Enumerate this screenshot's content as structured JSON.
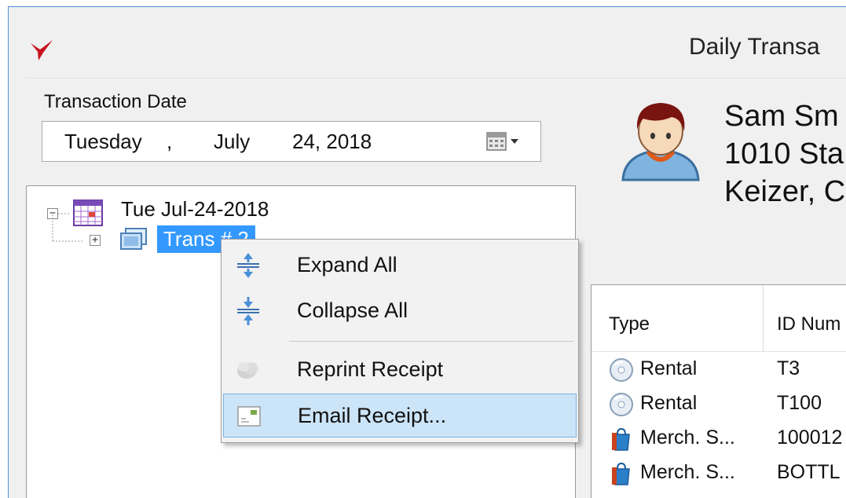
{
  "window": {
    "title": "Daily Transa"
  },
  "transaction_date": {
    "label": "Transaction Date",
    "day": "Tuesday",
    "comma": ",",
    "month": "July",
    "rest": "24, 2018"
  },
  "tree": {
    "root_label": "Tue Jul-24-2018",
    "root_expander": "−",
    "child_label": "Trans # 2",
    "child_expander": "+"
  },
  "customer": {
    "name": "Sam Sm",
    "address": "1010 Sta",
    "city": "Keizer, C"
  },
  "grid": {
    "headers": {
      "type": "Type",
      "id": "ID Num"
    },
    "rows": [
      {
        "type": "Rental",
        "id": "T3",
        "icon": "disc-icon"
      },
      {
        "type": "Rental",
        "id": "T100",
        "icon": "disc-icon"
      },
      {
        "type": "Merch. S...",
        "id": "100012",
        "icon": "shopping-bag-icon"
      },
      {
        "type": "Merch. S...",
        "id": "BOTTL",
        "icon": "shopping-bag-icon"
      }
    ]
  },
  "context_menu": {
    "items": [
      {
        "label": "Expand All",
        "icon": "expand-all-icon"
      },
      {
        "label": "Collapse All",
        "icon": "collapse-all-icon"
      },
      {
        "label": "Reprint Receipt",
        "icon": "reprint-receipt-icon"
      },
      {
        "label": "Email Receipt...",
        "icon": "email-receipt-icon"
      }
    ]
  },
  "colors": {
    "selection": "#3399ff",
    "menu_highlight": "#cce4f7",
    "window_border": "#4f8fd6",
    "logo_red": "#c8141e"
  }
}
